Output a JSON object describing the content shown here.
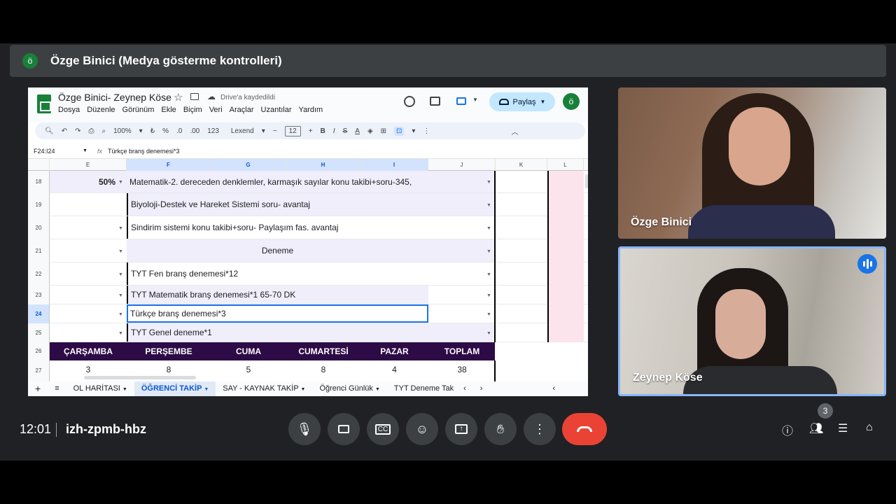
{
  "presenter_bar": {
    "avatar_letter": "ö",
    "title": "Özge Binici (Medya gösterme kontrolleri)"
  },
  "sheet": {
    "doc_title": "Özge Binici- Zeynep Köse",
    "saved_status": "Drive'a kaydedildi",
    "menus": [
      "Dosya",
      "Düzenle",
      "Görünüm",
      "Ekle",
      "Biçim",
      "Veri",
      "Araçlar",
      "Uzantılar",
      "Yardım"
    ],
    "share_label": "Paylaş",
    "account_letter": "ö",
    "toolbar": {
      "zoom": "100%",
      "currency": "₺",
      "percent": "%",
      "dec_down": ".0",
      "dec_up": ".00",
      "number_format": "123",
      "font": "Lexend",
      "font_size": "12",
      "bold": "B",
      "italic": "I",
      "strike": "S",
      "text_color": "A"
    },
    "cell_ref": "F24:I24",
    "formula": "Türkçe branş denemesi*3",
    "columns": [
      "E",
      "F",
      "G",
      "H",
      "I",
      "J",
      "K",
      "L"
    ],
    "rows": [
      {
        "num": "18",
        "e": "50%",
        "f": "Matematik-2. dereceden denklemler, karmaşık sayılar konu takibi+soru-345,"
      },
      {
        "num": "19",
        "e": "",
        "f": "Biyoloji-Destek ve Hareket Sistemi soru- avantaj"
      },
      {
        "num": "20",
        "e": "",
        "f": "Sindirim sistemi konu takibi+soru- Paylaşım fas. avantaj"
      },
      {
        "num": "21",
        "e": "",
        "f": "Deneme"
      },
      {
        "num": "22",
        "e": "",
        "f": "TYT Fen branş denemesi*12"
      },
      {
        "num": "23",
        "e": "",
        "f": "TYT Matematik branş denemesi*1 65-70 DK"
      },
      {
        "num": "24",
        "e": "",
        "f": "Türkçe branş denemesi*3"
      },
      {
        "num": "25",
        "e": "",
        "f": "TYT Genel deneme*1"
      }
    ],
    "row26_num": "26",
    "row27_num": "27",
    "day_headers": [
      "ÇARŞAMBA",
      "PERŞEMBE",
      "CUMA",
      "CUMARTESİ",
      "PAZAR",
      "TOPLAM"
    ],
    "day_values": [
      "3",
      "8",
      "5",
      "8",
      "4",
      "38"
    ],
    "tabs": [
      "OL HARİTASI",
      "ÖĞRENCİ TAKİP",
      "SAY - KAYNAK TAKİP",
      "Öğrenci Günlük",
      "TYT Deneme Tak"
    ],
    "active_tab": 1
  },
  "participants": [
    {
      "name": "Özge Binici",
      "speaking": false
    },
    {
      "name": "Zeynep Köse",
      "speaking": true
    }
  ],
  "meeting": {
    "time": "12:01",
    "code": "izh-zpmb-hbz",
    "participant_count": "3"
  },
  "colors": {
    "accent": "#1a73e8",
    "hangup": "#ea4335",
    "header_row": "#2d0b46",
    "sheet_green": "#188038"
  }
}
